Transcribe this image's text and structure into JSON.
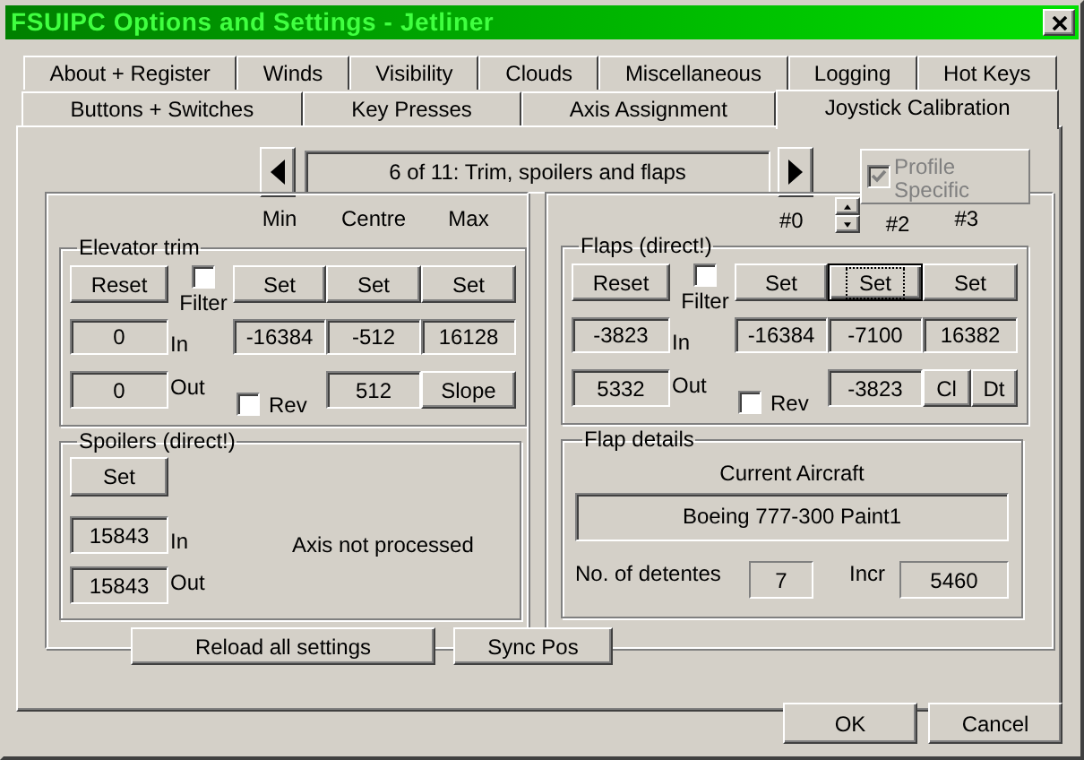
{
  "window": {
    "title": "FSUIPC Options and Settings - Jetliner"
  },
  "tab_rows": [
    {
      "tabs": [
        {
          "label": "About + Register",
          "selected": false
        },
        {
          "label": "Winds",
          "selected": false
        },
        {
          "label": "Visibility",
          "selected": false
        },
        {
          "label": "Clouds",
          "selected": false
        },
        {
          "label": "Miscellaneous",
          "selected": false
        },
        {
          "label": "Logging",
          "selected": false
        },
        {
          "label": "Hot Keys",
          "selected": false
        }
      ]
    },
    {
      "tabs": [
        {
          "label": "Buttons + Switches",
          "selected": false
        },
        {
          "label": "Key Presses",
          "selected": false
        },
        {
          "label": "Axis Assignment",
          "selected": false
        },
        {
          "label": "Joystick Calibration",
          "selected": true
        }
      ]
    }
  ],
  "page_selector": {
    "label": "6 of 11: Trim, spoilers and flaps"
  },
  "profile_specific": {
    "label": "Profile Specific",
    "checked": true,
    "disabled": true
  },
  "left_headers": [
    "Min",
    "Centre",
    "Max"
  ],
  "elevator_trim": {
    "title": "Elevator trim",
    "reset": "Reset",
    "filter": {
      "label": "Filter",
      "checked": false
    },
    "set_buttons": [
      {
        "label": "Set",
        "focused": false
      },
      {
        "label": "Set",
        "focused": false
      },
      {
        "label": "Set",
        "focused": false
      }
    ],
    "in": {
      "value": "0",
      "label": "In"
    },
    "out": {
      "value": "0",
      "label": "Out"
    },
    "calibration": [
      "-16384",
      "-512",
      "16128"
    ],
    "rev": {
      "label": "Rev",
      "checked": false
    },
    "extra_value": "512",
    "extra_buttons": [
      "Slope"
    ]
  },
  "spoilers": {
    "title": "Spoilers (direct!)",
    "set": "Set",
    "in": {
      "value": "15843",
      "label": "In"
    },
    "out": {
      "value": "15843",
      "label": "Out"
    },
    "message": "Axis not processed"
  },
  "right_headers": [
    "#0",
    "#2",
    "#3"
  ],
  "flaps": {
    "title": "Flaps (direct!)",
    "reset": "Reset",
    "filter": {
      "label": "Filter",
      "checked": false
    },
    "set_buttons": [
      {
        "label": "Set",
        "focused": false
      },
      {
        "label": "Set",
        "focused": true
      },
      {
        "label": "Set",
        "focused": false
      }
    ],
    "in": {
      "value": "-3823",
      "label": "In"
    },
    "out": {
      "value": "5332",
      "label": "Out"
    },
    "calibration": [
      "-16384",
      "-7100",
      "16382"
    ],
    "rev": {
      "label": "Rev",
      "checked": false
    },
    "extra_value": "-3823",
    "extra_buttons": [
      "Cl",
      "Dt"
    ]
  },
  "flap_details": {
    "title": "Flap details",
    "current_aircraft_label": "Current Aircraft",
    "aircraft": "Boeing 777-300 Paint1",
    "detentes_label": "No. of detentes",
    "detentes": "7",
    "incr_label": "Incr",
    "incr": "5460"
  },
  "actions": [
    "Reload all settings",
    "Sync Pos"
  ],
  "dialog_buttons": [
    "OK",
    "Cancel"
  ]
}
